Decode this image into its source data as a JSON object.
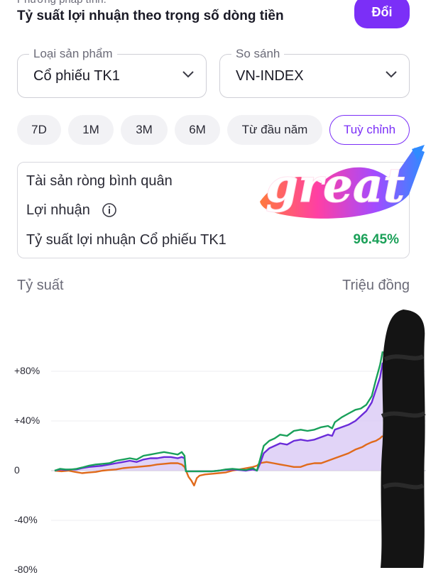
{
  "header": {
    "cut_label": "Phương pháp tính:",
    "title": "Tỷ suất lợi nhuận theo trọng số dòng tiền",
    "change_button": "Đổi"
  },
  "selectors": {
    "product": {
      "label": "Loại sản phẩm",
      "value": "Cổ phiếu TK1"
    },
    "compare": {
      "label": "So sánh",
      "value": "VN-INDEX"
    }
  },
  "periods": [
    {
      "label": "7D"
    },
    {
      "label": "1M"
    },
    {
      "label": "3M"
    },
    {
      "label": "6M"
    },
    {
      "label": "Từ đầu năm"
    },
    {
      "label": "Tuỳ chỉnh",
      "active": true
    }
  ],
  "summary": {
    "avg_net_assets_label": "Tài sản ròng bình quân",
    "profit_label": "Lợi nhuận",
    "return_label": "Tỷ suất lợi nhuận Cổ phiếu TK1",
    "return_value": "96.45%"
  },
  "sticker": {
    "text": "great"
  },
  "colors": {
    "accent": "#7b2ff7",
    "positive": "#1aa058",
    "series_portfolio": "#6a2bd9",
    "series_fill": "#d9c9f5",
    "series_green": "#19a05a",
    "series_index": "#e06a1b"
  },
  "chart_data": {
    "type": "line",
    "left_axis_label": "Tỷ suất",
    "right_axis_label": "Triệu đồng",
    "y_ticks": [
      "+80%",
      "+40%",
      "0",
      "-40%",
      "-80%"
    ],
    "y_tick_values": [
      80,
      40,
      0,
      -40,
      -80
    ],
    "ylim": [
      -80,
      100
    ],
    "grid": true,
    "series": [
      {
        "key": "portfolio",
        "fill": true,
        "points": [
          [
            0,
            0
          ],
          [
            4,
            1
          ],
          [
            8,
            0.5
          ],
          [
            12,
            1
          ],
          [
            16,
            1
          ],
          [
            20,
            2
          ],
          [
            25,
            3
          ],
          [
            30,
            3.5
          ],
          [
            35,
            4
          ],
          [
            40,
            5
          ],
          [
            45,
            6
          ],
          [
            50,
            7
          ],
          [
            55,
            8
          ],
          [
            60,
            7
          ],
          [
            65,
            9
          ],
          [
            70,
            10
          ],
          [
            75,
            10
          ],
          [
            80,
            11
          ],
          [
            85,
            11
          ],
          [
            90,
            10
          ],
          [
            93,
            11
          ],
          [
            95,
            10
          ],
          [
            96,
            -0.5
          ],
          [
            105,
            -0.5
          ],
          [
            110,
            -0.5
          ],
          [
            115,
            -0.5
          ],
          [
            120,
            0
          ],
          [
            125,
            0.5
          ],
          [
            130,
            1
          ],
          [
            135,
            0.5
          ],
          [
            140,
            0
          ],
          [
            145,
            1
          ],
          [
            148,
            0
          ],
          [
            150,
            5
          ],
          [
            153,
            14
          ],
          [
            157,
            18
          ],
          [
            161,
            20
          ],
          [
            165,
            22
          ],
          [
            170,
            21
          ],
          [
            175,
            24
          ],
          [
            180,
            25
          ],
          [
            185,
            24
          ],
          [
            190,
            25
          ],
          [
            195,
            27
          ],
          [
            200,
            29
          ],
          [
            203,
            28
          ],
          [
            205,
            33
          ],
          [
            210,
            35
          ],
          [
            215,
            37
          ],
          [
            220,
            40
          ],
          [
            224,
            44
          ],
          [
            228,
            48
          ],
          [
            232,
            55
          ],
          [
            235,
            65
          ],
          [
            238,
            75
          ],
          [
            240,
            87
          ]
        ]
      },
      {
        "key": "green",
        "fill": false,
        "points": [
          [
            0,
            0
          ],
          [
            4,
            1.5
          ],
          [
            8,
            1
          ],
          [
            12,
            1
          ],
          [
            16,
            1.5
          ],
          [
            20,
            2.5
          ],
          [
            25,
            4
          ],
          [
            30,
            5
          ],
          [
            35,
            5.5
          ],
          [
            40,
            6
          ],
          [
            45,
            8
          ],
          [
            50,
            9
          ],
          [
            55,
            10
          ],
          [
            60,
            9
          ],
          [
            65,
            12
          ],
          [
            70,
            13
          ],
          [
            75,
            14
          ],
          [
            80,
            15
          ],
          [
            85,
            14
          ],
          [
            90,
            13
          ],
          [
            93,
            15
          ],
          [
            95,
            12
          ],
          [
            96,
            -0.5
          ],
          [
            105,
            -0.5
          ],
          [
            110,
            -0.5
          ],
          [
            115,
            -0.5
          ],
          [
            120,
            0
          ],
          [
            125,
            1
          ],
          [
            130,
            1.5
          ],
          [
            135,
            1
          ],
          [
            140,
            0.5
          ],
          [
            145,
            2
          ],
          [
            148,
            0
          ],
          [
            150,
            8
          ],
          [
            153,
            20
          ],
          [
            157,
            24
          ],
          [
            161,
            26
          ],
          [
            165,
            29
          ],
          [
            170,
            28
          ],
          [
            175,
            32
          ],
          [
            180,
            33
          ],
          [
            185,
            32
          ],
          [
            190,
            33
          ],
          [
            195,
            35
          ],
          [
            200,
            36
          ],
          [
            203,
            34
          ],
          [
            205,
            39
          ],
          [
            210,
            43
          ],
          [
            215,
            46
          ],
          [
            220,
            49
          ],
          [
            224,
            50
          ],
          [
            228,
            53
          ],
          [
            232,
            60
          ],
          [
            235,
            73
          ],
          [
            238,
            85
          ],
          [
            240,
            96
          ]
        ]
      },
      {
        "key": "vnindex",
        "fill": false,
        "points": [
          [
            0,
            0
          ],
          [
            5,
            -0.5
          ],
          [
            10,
            0
          ],
          [
            15,
            -1
          ],
          [
            20,
            -2
          ],
          [
            25,
            -1.5
          ],
          [
            30,
            -1
          ],
          [
            35,
            0
          ],
          [
            40,
            0.5
          ],
          [
            45,
            1
          ],
          [
            50,
            2
          ],
          [
            55,
            2.5
          ],
          [
            60,
            3
          ],
          [
            65,
            3.5
          ],
          [
            70,
            4
          ],
          [
            75,
            5
          ],
          [
            80,
            5.5
          ],
          [
            85,
            6
          ],
          [
            90,
            6
          ],
          [
            93,
            5
          ],
          [
            95,
            3
          ],
          [
            98,
            -5
          ],
          [
            100,
            -8
          ],
          [
            102,
            -12
          ],
          [
            104,
            -6
          ],
          [
            106,
            -4
          ],
          [
            110,
            -3
          ],
          [
            115,
            -2.5
          ],
          [
            120,
            -2
          ],
          [
            125,
            -1.5
          ],
          [
            130,
            0
          ],
          [
            135,
            1
          ],
          [
            140,
            2
          ],
          [
            145,
            3
          ],
          [
            148,
            4
          ],
          [
            150,
            6
          ],
          [
            155,
            7
          ],
          [
            160,
            6
          ],
          [
            165,
            5
          ],
          [
            170,
            4
          ],
          [
            175,
            3
          ],
          [
            180,
            3
          ],
          [
            185,
            5
          ],
          [
            190,
            6
          ],
          [
            195,
            6
          ],
          [
            200,
            8
          ],
          [
            205,
            10
          ],
          [
            210,
            12
          ],
          [
            215,
            14
          ],
          [
            220,
            17
          ],
          [
            225,
            19
          ],
          [
            228,
            21
          ],
          [
            232,
            23
          ],
          [
            235,
            24
          ],
          [
            238,
            26
          ],
          [
            240,
            28
          ]
        ]
      }
    ]
  }
}
